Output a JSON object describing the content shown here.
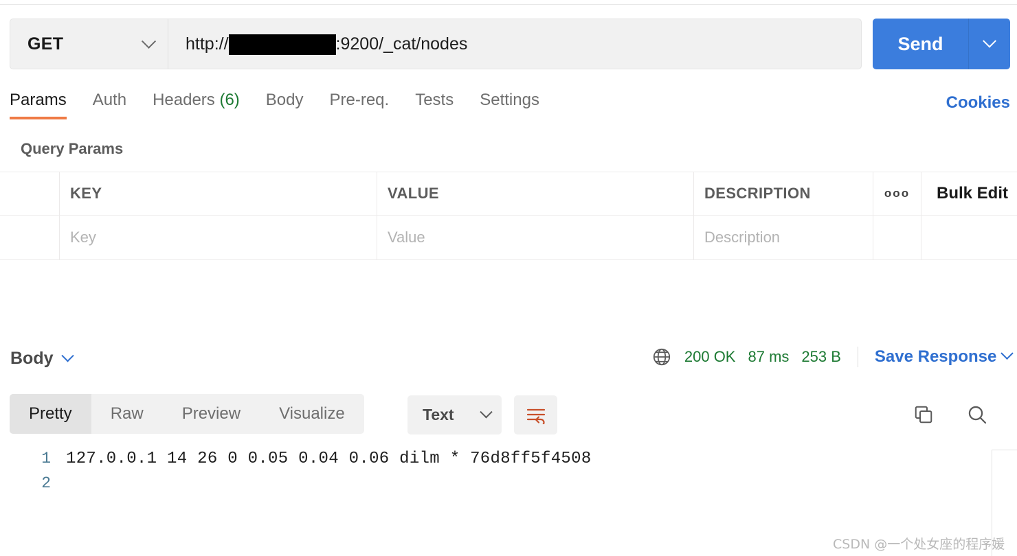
{
  "request": {
    "method": "GET",
    "method_caret_icon": "chevron-down-icon",
    "url_prefix": "http://",
    "url_redacted": true,
    "url_suffix": ":9200/_cat/nodes",
    "send_label": "Send",
    "send_caret_icon": "chevron-down-icon"
  },
  "request_tabs": [
    {
      "label": "Params",
      "active": true,
      "count": ""
    },
    {
      "label": "Auth",
      "active": false,
      "count": ""
    },
    {
      "label": "Headers",
      "active": false,
      "count": "(6)"
    },
    {
      "label": "Body",
      "active": false,
      "count": ""
    },
    {
      "label": "Pre-req.",
      "active": false,
      "count": ""
    },
    {
      "label": "Tests",
      "active": false,
      "count": ""
    },
    {
      "label": "Settings",
      "active": false,
      "count": ""
    }
  ],
  "cookies_label": "Cookies",
  "query_params": {
    "section_title": "Query Params",
    "columns": [
      "KEY",
      "VALUE",
      "DESCRIPTION"
    ],
    "more_options_icon": "ellipsis-icon",
    "bulk_edit_label": "Bulk Edit",
    "row_placeholders": {
      "key": "Key",
      "value": "Value",
      "description": "Description"
    }
  },
  "response": {
    "body_label": "Body",
    "body_caret_icon": "chevron-down-icon",
    "globe_icon": "globe-icon",
    "status": "200 OK",
    "time": "87 ms",
    "size": "253 B",
    "save_response_label": "Save Response",
    "save_caret_icon": "chevron-down-icon",
    "view_tabs": [
      {
        "label": "Pretty",
        "active": true
      },
      {
        "label": "Raw",
        "active": false
      },
      {
        "label": "Preview",
        "active": false
      },
      {
        "label": "Visualize",
        "active": false
      }
    ],
    "format_select": "Text",
    "format_caret_icon": "chevron-down-icon",
    "wrap_icon": "text-wrap-icon",
    "copy_icon": "copy-icon",
    "search_icon": "search-icon",
    "lines": [
      {
        "number": "1",
        "text": "127.0.0.1 14 26 0 0.05 0.04 0.06 dilm * 76d8ff5f4508"
      },
      {
        "number": "2",
        "text": ""
      }
    ]
  },
  "watermark": "CSDN @一个处女座的程序媛",
  "colors": {
    "accent_orange": "#ef7b45",
    "link_blue": "#2f6fd0",
    "send_blue": "#3b7ddd",
    "status_green": "#1d7a33",
    "gutter_blue": "#4a7a93"
  }
}
